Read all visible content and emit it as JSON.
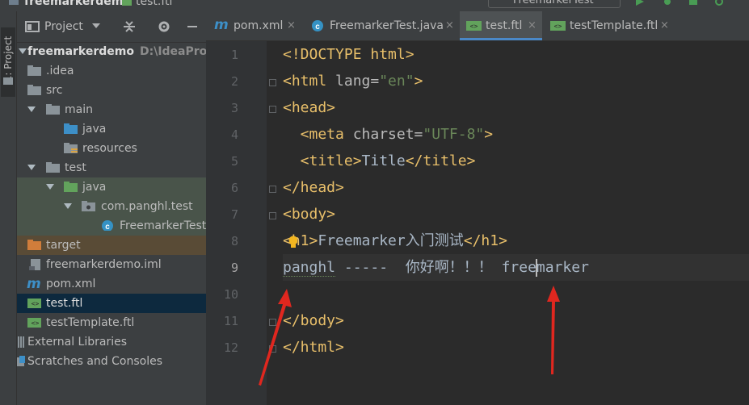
{
  "topbar": {
    "project_crumb": "freemarkerdemo",
    "file_crumb": "test.ftl",
    "run_config": "FreemarkerTest"
  },
  "left_strip": {
    "tool_window": "1: Project"
  },
  "project_panel": {
    "title": "Project",
    "tree": [
      {
        "label": "freemarkerdemo",
        "path": "D:\\IdeaProject",
        "icon": "module-folder-icon",
        "arrow": "down",
        "level": 0,
        "bold": true
      },
      {
        "label": ".idea",
        "icon": "folder-icon",
        "arrow": "none",
        "level": 1
      },
      {
        "label": "src",
        "icon": "folder-icon",
        "arrow": "none",
        "level": 1
      },
      {
        "label": "main",
        "icon": "folder-icon",
        "arrow": "down",
        "level": 1
      },
      {
        "label": "java",
        "icon": "source-folder-icon",
        "arrow": "none",
        "level": 2
      },
      {
        "label": "resources",
        "icon": "resources-folder-icon",
        "arrow": "none",
        "level": 2
      },
      {
        "label": "test",
        "icon": "folder-icon",
        "arrow": "down",
        "level": 1
      },
      {
        "label": "java",
        "icon": "test-folder-icon",
        "arrow": "down",
        "level": 2,
        "highlight": "green"
      },
      {
        "label": "com.panghl.test",
        "icon": "package-icon",
        "arrow": "down",
        "level": 3,
        "highlight": "green"
      },
      {
        "label": "FreemarkerTest",
        "icon": "java-class-icon",
        "arrow": "none",
        "level": 4,
        "highlight": "green"
      },
      {
        "label": "target",
        "icon": "excluded-folder-icon",
        "arrow": "none",
        "level": 1,
        "highlight": "brown"
      },
      {
        "label": "freemarkerdemo.iml",
        "icon": "iml-file-icon",
        "arrow": "none",
        "level": 1
      },
      {
        "label": "pom.xml",
        "icon": "maven-icon",
        "arrow": "none",
        "level": 1
      },
      {
        "label": "test.ftl",
        "icon": "ftl-file-icon",
        "arrow": "none",
        "level": 1,
        "highlight": "selected"
      },
      {
        "label": "testTemplate.ftl",
        "icon": "ftl-file-icon",
        "arrow": "none",
        "level": 1
      },
      {
        "label": "External Libraries",
        "icon": "libraries-icon",
        "arrow": "none",
        "level": 0
      },
      {
        "label": "Scratches and Consoles",
        "icon": "scratches-icon",
        "arrow": "none",
        "level": 0
      }
    ]
  },
  "tabs": [
    {
      "label": "pom.xml",
      "icon": "maven-icon",
      "close": "×"
    },
    {
      "label": "FreemarkerTest.java",
      "icon": "java-class-icon",
      "close": "×"
    },
    {
      "label": "test.ftl",
      "icon": "ftl-file-icon",
      "close": "×",
      "active": true
    },
    {
      "label": "testTemplate.ftl",
      "icon": "ftl-file-icon",
      "close": "×"
    }
  ],
  "editor": {
    "line_numbers": [
      "1",
      "2",
      "3",
      "4",
      "5",
      "6",
      "7",
      "8",
      "9",
      "10",
      "11",
      "12"
    ],
    "lines": {
      "l1": {
        "a": "<!DOCTYPE html>"
      },
      "l2": {
        "a": "<html ",
        "b": "lang=",
        "c": "\"en\"",
        "d": ">"
      },
      "l3": {
        "a": "<head>"
      },
      "l4": {
        "a": "  <meta ",
        "b": "charset=",
        "c": "\"UTF-8\"",
        "d": ">"
      },
      "l5": {
        "a": "  <title>",
        "b": "Title",
        "c": "</title>"
      },
      "l6": {
        "a": "</head>"
      },
      "l7": {
        "a": "<body>"
      },
      "l8": {
        "a": "<h1>",
        "b": "Freemarker入门测试",
        "c": "</h1>"
      },
      "l9": {
        "a": "panghl",
        "b": " -----  你好啊！！！ free",
        "c": "marker"
      },
      "l11": {
        "a": "</body>"
      },
      "l12": {
        "a": "</html>"
      }
    }
  }
}
